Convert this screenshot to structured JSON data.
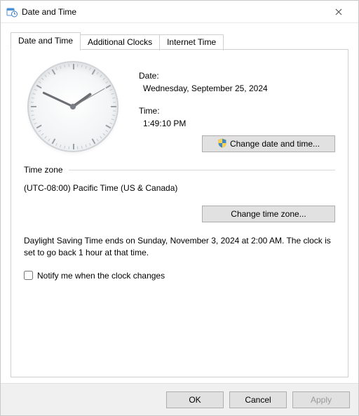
{
  "window": {
    "title": "Date and Time"
  },
  "tabs": [
    {
      "label": "Date and Time",
      "active": true
    },
    {
      "label": "Additional Clocks",
      "active": false
    },
    {
      "label": "Internet Time",
      "active": false
    }
  ],
  "date": {
    "label": "Date:",
    "value": "Wednesday, September 25, 2024"
  },
  "time": {
    "label": "Time:",
    "value": "1:49:10 PM",
    "hour": 1,
    "minute": 49,
    "second": 10,
    "is_pm": true
  },
  "change_datetime_button": "Change date and time...",
  "timezone": {
    "section_title": "Time zone",
    "value": "(UTC-08:00) Pacific Time (US & Canada)",
    "change_button": "Change time zone..."
  },
  "dst_text": "Daylight Saving Time ends on Sunday, November 3, 2024 at 2:00 AM. The clock is set to go back 1 hour at that time.",
  "notify_checkbox": {
    "label": "Notify me when the clock changes",
    "checked": false
  },
  "footer": {
    "ok": "OK",
    "cancel": "Cancel",
    "apply": "Apply"
  }
}
